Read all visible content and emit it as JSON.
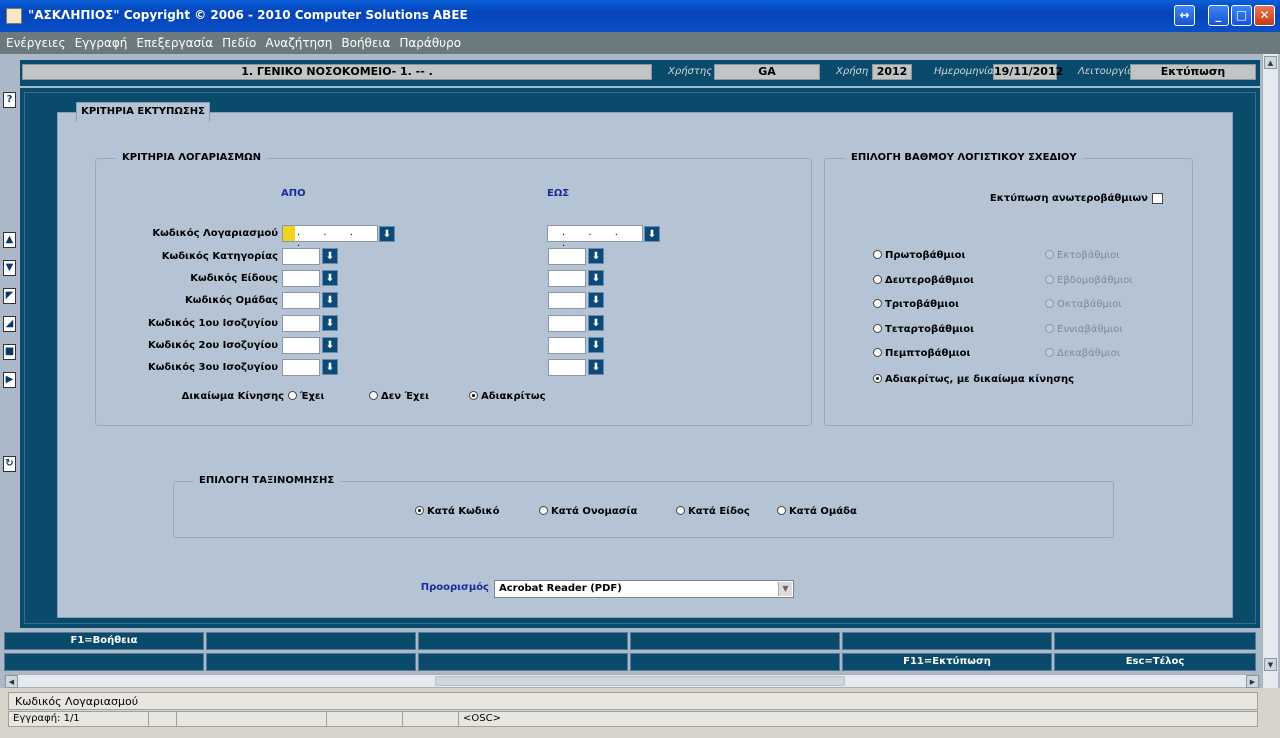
{
  "window": {
    "title": "\"ΑΣΚΛΗΠΙΟΣ\" Copyright © 2006 - 2010 Computer Solutions ΑΒΕΕ",
    "restore_glyph": "↔",
    "min_glyph": "_",
    "max_glyph": "□",
    "close_glyph": "✕"
  },
  "menu": [
    "Ενέργειες",
    "Εγγραφή",
    "Επεξεργασία",
    "Πεδίο",
    "Αναζήτηση",
    "Βοήθεια",
    "Παράθυρο"
  ],
  "header": {
    "organization": "1. ΓΕΝΙΚΟ ΝΟΣΟΚΟΜΕΙΟ- 1. -- .",
    "user_label": "Χρήστης",
    "user": "GA",
    "year_label": "Χρήση",
    "year": "2012",
    "date_label": "Ημερομηνία",
    "date": "19/11/2012",
    "mode_label": "Λειτουργία",
    "mode": "Εκτύπωση"
  },
  "left_toolbar": {
    "help": "?",
    "icons": [
      "arrow-up-icon",
      "arrow-down-icon",
      "first-record-icon",
      "last-record-icon",
      "stop-icon",
      "next-icon",
      "refresh-icon"
    ]
  },
  "form": {
    "tab_label": "ΚΡΙΤΗΡΙΑ ΕΚΤΥΠΩΣΗΣ",
    "accounts": {
      "legend": "ΚΡΙΤΗΡΙΑ ΛΟΓΑΡΙΑΣΜΩΝ",
      "from_label": "ΑΠΟ",
      "to_label": "ΕΩΣ",
      "account_mask": ". . . .",
      "fields": [
        "Κωδικός Λογαριασμού",
        "Κωδικός Κατηγορίας",
        "Κωδικός Είδους",
        "Κωδικός Ομάδας",
        "Κωδικός 1ου Ισοζυγίου",
        "Κωδικός 2ου Ισοζυγίου",
        "Κωδικός 3ου Ισοζυγίου"
      ],
      "lov_glyph": "⬇",
      "movement_label": "Δικαίωμα Κίνησης",
      "movement_options": [
        "Έχει",
        "Δεν Έχει",
        "Αδιακρίτως"
      ],
      "movement_selected": "Αδιακρίτως"
    },
    "level": {
      "legend": "ΕΠΙΛΟΓΗ ΒΑΘΜΟΥ ΛΟΓΙΣΤΙΚΟΥ ΣΧΕΔΙΟΥ",
      "print_higher_label": "Εκτύπωση ανωτεροβάθμιων",
      "print_higher_checked": false,
      "options_left": [
        "Πρωτοβάθμιοι",
        "Δευτεροβάθμιοι",
        "Τριτοβάθμιοι",
        "Τεταρτοβάθμιοι",
        "Πεμπτοβάθμιοι",
        "Αδιακρίτως, με δικαίωμα κίνησης"
      ],
      "options_right": [
        "Εκτοβάθμιοι",
        "Εβδομοβάθμιοι",
        "Οκταβάθμιοι",
        "Εννιαβάθμιοι",
        "Δεκαβάθμιοι"
      ],
      "selected": "Αδιακρίτως, με δικαίωμα κίνησης"
    },
    "sort": {
      "legend": "ΕΠΙΛΟΓΗ ΤΑΞΙΝΟΜΗΣΗΣ",
      "options": [
        "Κατά Κωδικό",
        "Κατά Ονομασία",
        "Κατά Είδος",
        "Κατά Ομάδα"
      ],
      "selected": "Κατά Κωδικό"
    },
    "destination": {
      "label": "Προορισμός",
      "value": "Acrobat Reader (PDF)",
      "arrow": "▼"
    }
  },
  "function_keys": {
    "row1": [
      "F1=Βοήθεια",
      "",
      "",
      "",
      "",
      ""
    ],
    "row2": [
      "",
      "",
      "",
      "",
      "F11=Εκτύπωση",
      "Esc=Τέλος"
    ]
  },
  "status": {
    "message": "Κωδικός Λογαριασμού",
    "record": "Εγγραφή: 1/1",
    "mode": "<OSC>"
  }
}
